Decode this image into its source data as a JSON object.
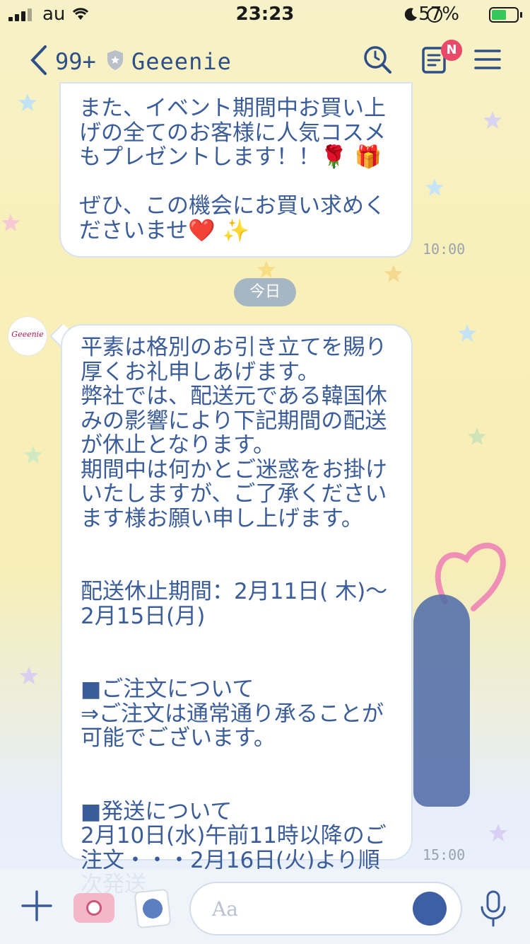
{
  "status_bar": {
    "carrier": "au",
    "time": "23:23",
    "battery": "57%"
  },
  "header": {
    "unread_count": "99+",
    "title": "Geeenie",
    "notes_badge": "N"
  },
  "messages": [
    {
      "text": "また、イベント期間中お買い上\nげの全てのお客様に人気コスメ\nもプレゼントします！！🌹 🎁\n\nぜひ、この機会にお買い求めく\nださいませ❤️ ✨",
      "time": "10:00"
    },
    {
      "date_separator": "今日",
      "avatar_text": "Geeenie",
      "text": "平素は格別のお引き立てを賜り\n厚くお礼申しあげます。\n弊社では、配送元である韓国休\nみの影響により下記期間の配送\nが休止となります。\n期間中は何かとご迷惑をお掛け\nいたしますが、ご了承ください\nます様お願い申し上げます。\n\n\n配送休止期間：2月11日( 木)〜\n2月15日(月)\n\n\n■ご注文について\n⇒ご注文は通常通り承ることが\n可能でございます。\n\n\n■発送について\n2月10日(水)午前11時以降のご\n注文・・・2月16日(火)より順\n次発送",
      "time": "15:00"
    }
  ],
  "composer": {
    "placeholder": "Aa"
  },
  "colors": {
    "accent": "#2e4f86",
    "message_text": "#3a5d9a",
    "badge": "#e94a6a",
    "date_pill": "#a7b6c3"
  }
}
